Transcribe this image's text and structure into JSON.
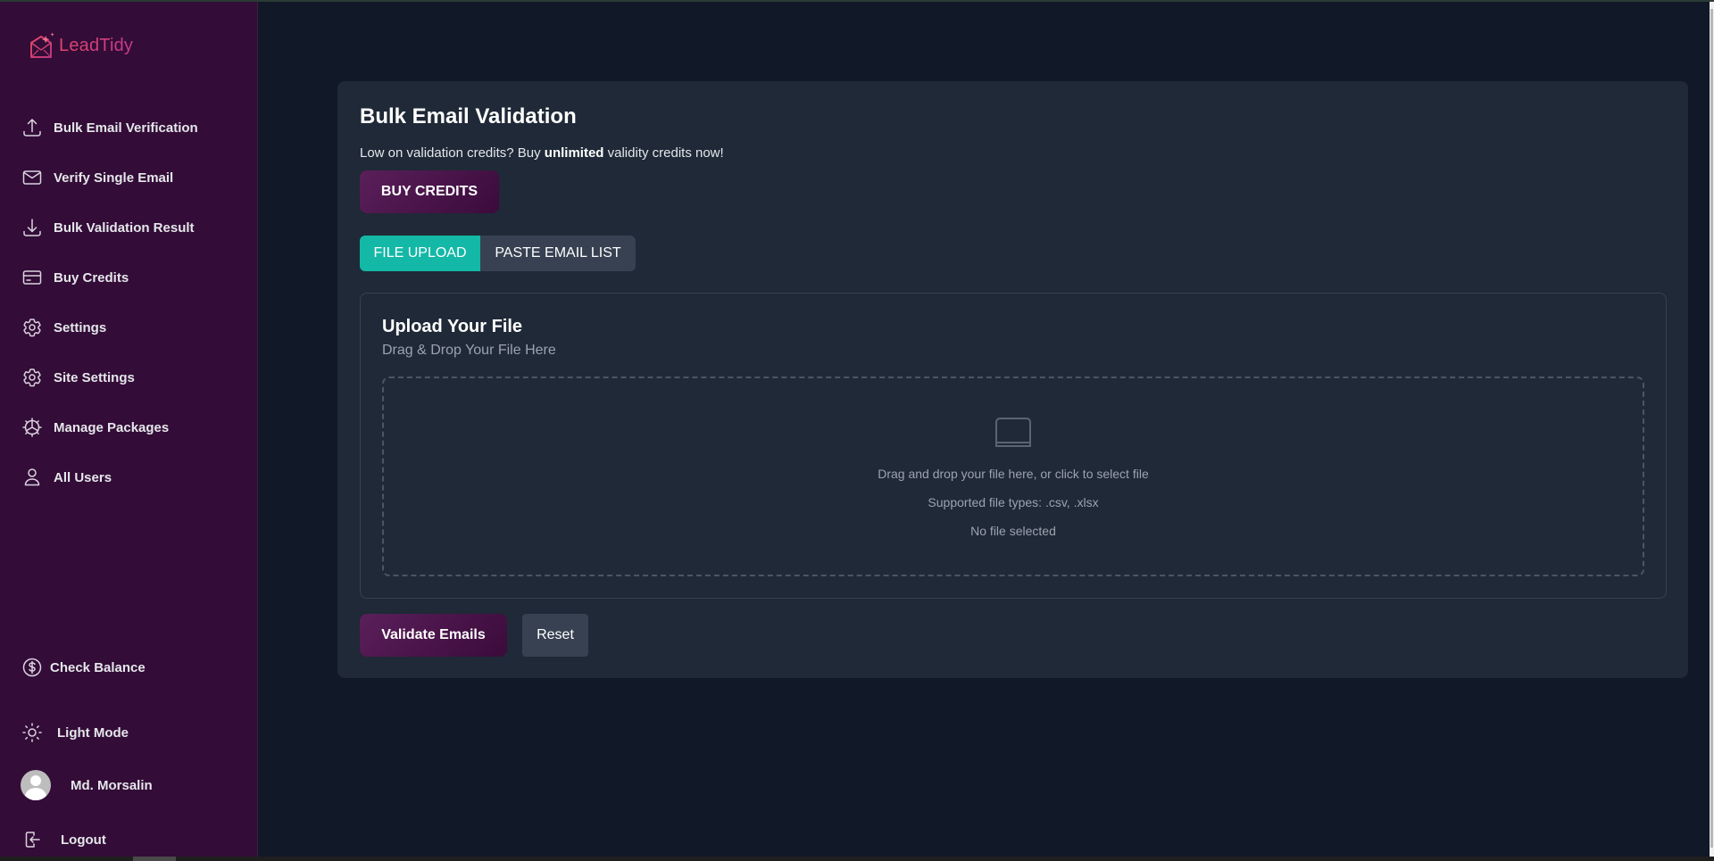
{
  "app": {
    "name": "LeadTidy",
    "brand_colors": {
      "primary_gradient_start": "#5a1f5a",
      "primary_gradient_end": "#3b0b3b",
      "accent": "#14b8a6",
      "logo": "#e0466a"
    }
  },
  "sidebar": {
    "items": [
      {
        "label": "Bulk Email Verification",
        "icon": "upload-icon"
      },
      {
        "label": "Verify Single Email",
        "icon": "mail-icon"
      },
      {
        "label": "Bulk Validation Result",
        "icon": "download-icon"
      },
      {
        "label": "Buy Credits",
        "icon": "credit-card-icon"
      },
      {
        "label": "Settings",
        "icon": "gear-icon"
      },
      {
        "label": "Site Settings",
        "icon": "gear-icon"
      },
      {
        "label": "Manage Packages",
        "icon": "packages-cog-icon"
      },
      {
        "label": "All Users",
        "icon": "user-icon"
      }
    ],
    "check_balance": "Check Balance",
    "theme_toggle": "Light Mode",
    "user_name": "Md. Morsalin",
    "logout": "Logout"
  },
  "main": {
    "title": "Bulk Email Validation",
    "promo": {
      "before": "Low on validation credits? Buy ",
      "bold": "unlimited",
      "after": " validity credits now!"
    },
    "buy_credits_label": "BUY CREDITS",
    "tabs": [
      {
        "label": "FILE UPLOAD",
        "active": true
      },
      {
        "label": "PASTE EMAIL LIST",
        "active": false
      }
    ],
    "upload": {
      "title": "Upload Your File",
      "subtitle": "Drag & Drop Your File Here",
      "drop_instruction": "Drag and drop your file here, or click to select file",
      "supported_types": "Supported file types: .csv, .xlsx",
      "file_status": "No file selected"
    },
    "validate_label": "Validate Emails",
    "reset_label": "Reset"
  }
}
